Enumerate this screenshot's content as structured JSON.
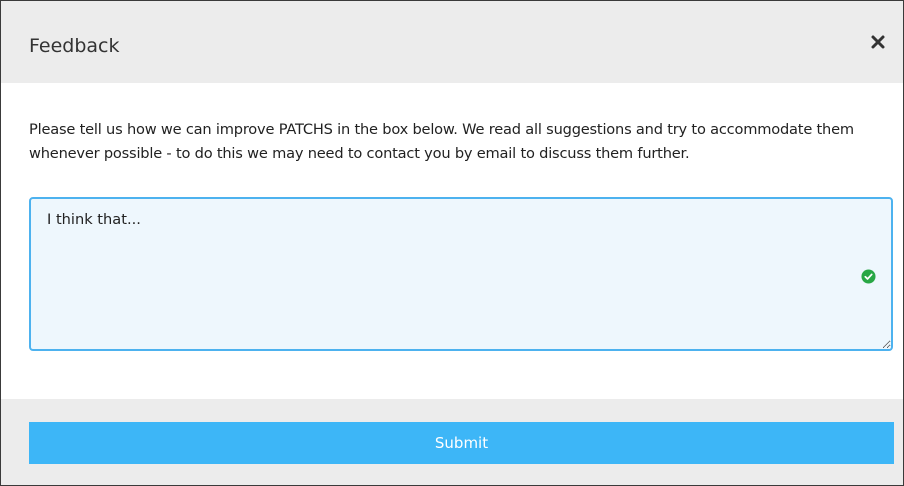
{
  "modal": {
    "title": "Feedback",
    "close_icon": "close-icon"
  },
  "body": {
    "description": "Please tell us how we can improve PATCHS in the box below. We read all suggestions and try to accommodate them whenever possible - to do this we may need to contact you by email to discuss them further.",
    "textarea_value": "I think that...",
    "valid_icon": "check-circle-icon"
  },
  "footer": {
    "submit_label": "Submit"
  },
  "colors": {
    "accent": "#3db6f7",
    "textarea_border": "#4db2ef",
    "textarea_bg": "#eef7fd",
    "header_bg": "#ececec",
    "valid_green": "#28a745"
  }
}
